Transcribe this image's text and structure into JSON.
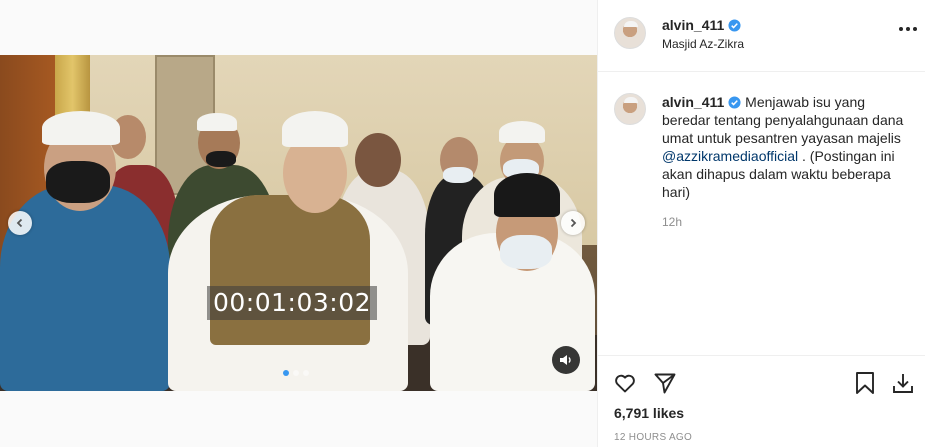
{
  "post": {
    "username": "alvin_411",
    "location": "Masjid Az-Zikra",
    "caption_prefix": "Menjawab isu yang beredar tentang penyalahgunaan dana umat untuk pesantren yayasan majelis ",
    "mention": "@azzikramediaofficial",
    "caption_suffix": " . (Postingan ini akan dihapus dalam waktu beberapa hari)",
    "comment_time": "12h",
    "likes": "6,791 likes",
    "posted": "12 HOURS AGO"
  },
  "media": {
    "timecode": "00:01:03:02",
    "carousel_count": 3,
    "carousel_active": 1
  },
  "icons": {
    "verified": "verified-badge-icon",
    "more": "more-options-icon",
    "like": "heart-icon",
    "share": "share-icon",
    "save": "bookmark-icon",
    "download": "download-icon",
    "sound": "speaker-icon",
    "prev": "chevron-left-icon",
    "next": "chevron-right-icon"
  },
  "colors": {
    "verified": "#3897f0",
    "mention": "#00376b",
    "secondary_text": "#8e8e8e"
  }
}
